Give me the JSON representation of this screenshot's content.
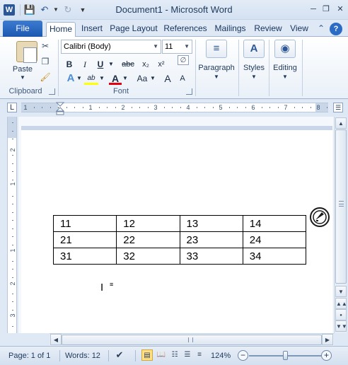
{
  "window": {
    "title": "Document1  -  Microsoft Word",
    "app_icon": "W"
  },
  "quick_access": {
    "save_icon": "save-icon",
    "undo_icon": "undo-icon",
    "redo_icon": "redo-icon",
    "customize_icon": "customize-icon"
  },
  "ribbon_tabs": {
    "file": "File",
    "items": [
      "Home",
      "Insert",
      "Page Layout",
      "References",
      "Mailings",
      "Review",
      "View"
    ],
    "active": "Home"
  },
  "clipboard": {
    "paste_label": "Paste",
    "group_label": "Clipboard"
  },
  "font": {
    "family": "Calibri (Body)",
    "size": "11",
    "group_label": "Font",
    "bold": "B",
    "italic": "I",
    "underline": "U",
    "strike": "abc",
    "subscript": "x₂",
    "superscript": "x²",
    "text_effects": "A",
    "highlight": "ab",
    "font_color": "A",
    "change_case": "Aa",
    "grow": "A",
    "shrink": "A",
    "clear": "A"
  },
  "groups": {
    "paragraph": "Paragraph",
    "styles": "Styles",
    "editing": "Editing"
  },
  "ruler": {
    "tab_stop": "L",
    "numbers": [
      "1",
      "1",
      "2",
      "3",
      "4",
      "5",
      "6",
      "7",
      "8"
    ],
    "vertical_numbers": [
      "2",
      "1",
      "1",
      "2",
      "3"
    ]
  },
  "table": {
    "rows": [
      [
        "11",
        "12",
        "13",
        "14"
      ],
      [
        "21",
        "22",
        "23",
        "24"
      ],
      [
        "31",
        "32",
        "33",
        "34"
      ]
    ]
  },
  "status": {
    "page": "Page: 1 of 1",
    "words": "Words: 12",
    "zoom": "124%",
    "zoom_level_percent": 124
  },
  "colors": {
    "file_tab": "#2b5797",
    "ribbon_bg": "#dfe9f5",
    "highlight_color": "#ffff00",
    "font_color_bar": "#e4000f"
  }
}
